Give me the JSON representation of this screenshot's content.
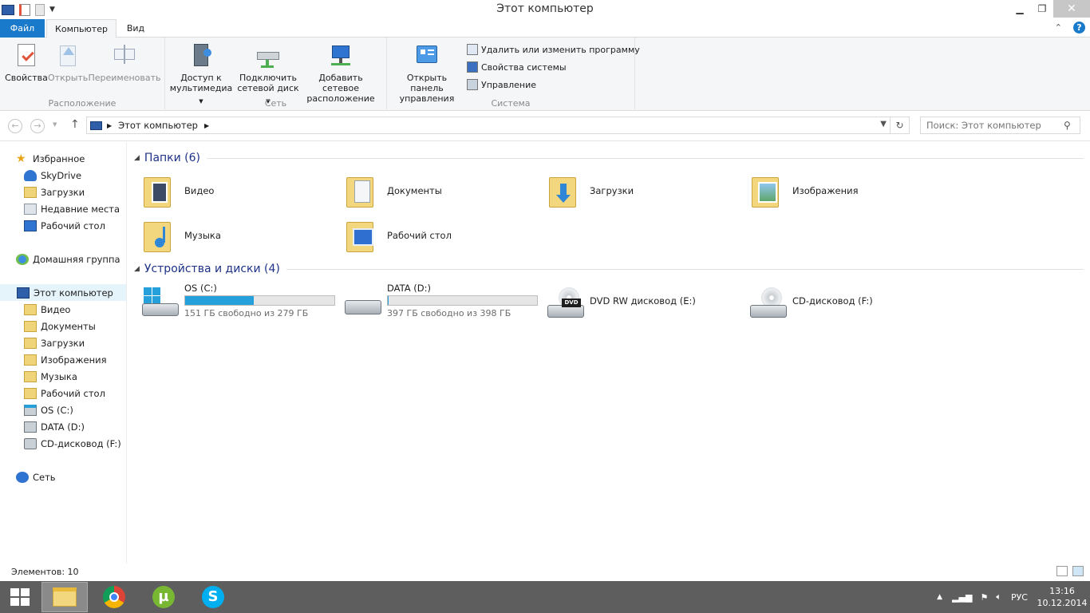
{
  "window": {
    "title": "Этот компьютер"
  },
  "tabs": [
    {
      "label": "Файл"
    },
    {
      "label": "Компьютер"
    },
    {
      "label": "Вид"
    }
  ],
  "ribbon": {
    "groups": [
      {
        "label": "Расположение",
        "buttons": [
          {
            "label": "Свойства"
          },
          {
            "label": "Открыть"
          },
          {
            "label": "Переименовать"
          }
        ]
      },
      {
        "label": "Сеть",
        "buttons": [
          {
            "label1": "Доступ к",
            "label2": "мультимедиа"
          },
          {
            "label1": "Подключить",
            "label2": "сетевой диск"
          },
          {
            "label1": "Добавить сетевое",
            "label2": "расположение"
          }
        ]
      },
      {
        "label": "Система",
        "buttons": [
          {
            "label1": "Открыть панель",
            "label2": "управления"
          }
        ],
        "small": [
          {
            "label": "Удалить или изменить программу"
          },
          {
            "label": "Свойства системы"
          },
          {
            "label": "Управление"
          }
        ]
      }
    ]
  },
  "address": {
    "path": "Этот компьютер",
    "search_placeholder": "Поиск: Этот компьютер"
  },
  "sidebar": {
    "items": [
      {
        "label": "Избранное"
      },
      {
        "label": "SkyDrive"
      },
      {
        "label": "Загрузки"
      },
      {
        "label": "Недавние места"
      },
      {
        "label": "Рабочий стол"
      },
      {
        "label": "Домашняя группа"
      },
      {
        "label": "Этот компьютер"
      },
      {
        "label": "Видео"
      },
      {
        "label": "Документы"
      },
      {
        "label": "Загрузки"
      },
      {
        "label": "Изображения"
      },
      {
        "label": "Музыка"
      },
      {
        "label": "Рабочий стол"
      },
      {
        "label": "OS (C:)"
      },
      {
        "label": "DATA (D:)"
      },
      {
        "label": "CD-дисковод (F:)"
      },
      {
        "label": "Сеть"
      }
    ]
  },
  "content": {
    "folders_header": "Папки (6)",
    "folders": [
      {
        "label": "Видео"
      },
      {
        "label": "Документы"
      },
      {
        "label": "Загрузки"
      },
      {
        "label": "Изображения"
      },
      {
        "label": "Музыка"
      },
      {
        "label": "Рабочий стол"
      }
    ],
    "drives_header": "Устройства и диски (4)",
    "drives": [
      {
        "label": "OS (C:)",
        "free": "151 ГБ свободно из 279 ГБ",
        "used_fraction": 0.459
      },
      {
        "label": "DATA (D:)",
        "free": "397 ГБ свободно из 398 ГБ",
        "used_fraction": 0.003
      },
      {
        "label": "DVD RW дисковод (E:)"
      },
      {
        "label": "CD-дисковод (F:)"
      }
    ]
  },
  "status": {
    "items_count": "Элементов: 10"
  },
  "taskbar": {
    "lang": "РУС",
    "time": "13:16",
    "date": "10.12.2014"
  },
  "colors": {
    "accent": "#1979ca",
    "drive_bar": "#26a0da",
    "taskbar": "#5e5e5e"
  }
}
